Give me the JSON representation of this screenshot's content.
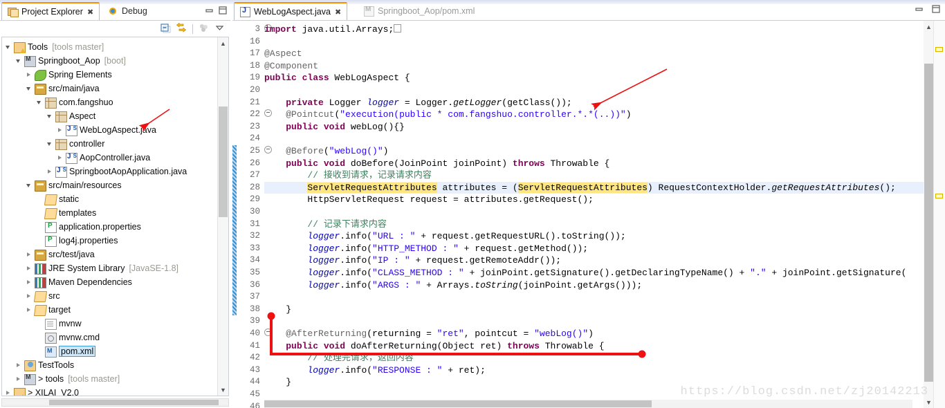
{
  "window": {
    "minimize_icon": "minimize-icon",
    "maximize_icon": "maximize-icon"
  },
  "left_view": {
    "tabs": [
      {
        "label": "Project Explorer",
        "icon": "project-explorer-icon",
        "active": true,
        "closable": true
      },
      {
        "label": "Debug",
        "icon": "debug-icon",
        "active": false,
        "closable": false
      }
    ],
    "toolbar": [
      {
        "name": "collapse-all-button",
        "icon": "collapse-all-icon"
      },
      {
        "name": "link-with-editor-button",
        "icon": "link-with-editor-icon"
      },
      {
        "name": "view-menu-button",
        "icon": "view-menu-icon"
      },
      {
        "name": "view-dropdown-button",
        "icon": "chevron-down-icon"
      }
    ],
    "tree": [
      {
        "indent": 0,
        "arrow": "open",
        "icon": "project-warn-icon",
        "name": "Tools",
        "meta": "[tools master]"
      },
      {
        "indent": 1,
        "arrow": "open",
        "icon": "git-project-icon",
        "name": "Springboot_Aop",
        "meta": "[boot]"
      },
      {
        "indent": 2,
        "arrow": "closed",
        "icon": "spring-icon",
        "name": "Spring Elements",
        "meta": ""
      },
      {
        "indent": 2,
        "arrow": "open",
        "icon": "source-folder-icon",
        "name": "src/main/java",
        "meta": ""
      },
      {
        "indent": 3,
        "arrow": "open",
        "icon": "package-icon",
        "name": "com.fangshuo",
        "meta": ""
      },
      {
        "indent": 4,
        "arrow": "open",
        "icon": "package-icon",
        "name": "Aspect",
        "meta": ""
      },
      {
        "indent": 5,
        "arrow": "closed",
        "icon": "java-class-icon",
        "name": "WebLogAspect.java",
        "meta": ""
      },
      {
        "indent": 4,
        "arrow": "open",
        "icon": "package-icon",
        "name": "controller",
        "meta": ""
      },
      {
        "indent": 5,
        "arrow": "closed",
        "icon": "java-class-icon",
        "name": "AopController.java",
        "meta": ""
      },
      {
        "indent": 4,
        "arrow": "closed",
        "icon": "java-class-icon",
        "name": "SpringbootAopApplication.java",
        "meta": ""
      },
      {
        "indent": 2,
        "arrow": "open",
        "icon": "source-folder-icon",
        "name": "src/main/resources",
        "meta": ""
      },
      {
        "indent": 3,
        "arrow": "none",
        "icon": "folder-open-icon",
        "name": "static",
        "meta": ""
      },
      {
        "indent": 3,
        "arrow": "none",
        "icon": "folder-open-icon",
        "name": "templates",
        "meta": ""
      },
      {
        "indent": 3,
        "arrow": "none",
        "icon": "properties-icon",
        "name": "application.properties",
        "meta": ""
      },
      {
        "indent": 3,
        "arrow": "none",
        "icon": "properties-icon",
        "name": "log4j.properties",
        "meta": ""
      },
      {
        "indent": 2,
        "arrow": "closed",
        "icon": "source-folder-icon",
        "name": "src/test/java",
        "meta": ""
      },
      {
        "indent": 2,
        "arrow": "closed",
        "icon": "library-icon",
        "name": "JRE System Library",
        "meta": "[JavaSE-1.8]"
      },
      {
        "indent": 2,
        "arrow": "closed",
        "icon": "library-icon",
        "name": "Maven Dependencies",
        "meta": ""
      },
      {
        "indent": 2,
        "arrow": "closed",
        "icon": "folder-open-icon",
        "name": "src",
        "meta": ""
      },
      {
        "indent": 2,
        "arrow": "closed",
        "icon": "folder-open-icon",
        "name": "target",
        "meta": ""
      },
      {
        "indent": 3,
        "arrow": "none",
        "icon": "file-icon",
        "name": "mvnw",
        "meta": ""
      },
      {
        "indent": 3,
        "arrow": "none",
        "icon": "cmd-file-icon",
        "name": "mvnw.cmd",
        "meta": ""
      },
      {
        "indent": 3,
        "arrow": "none",
        "icon": "maven-xml-icon",
        "name": "pom.xml",
        "meta": "",
        "selected": true
      },
      {
        "indent": 1,
        "arrow": "closed",
        "icon": "test-project-icon",
        "name": "TestTools",
        "meta": ""
      },
      {
        "indent": 1,
        "arrow": "closed",
        "icon": "git-project-icon",
        "name": "> tools",
        "meta": "[tools master]"
      },
      {
        "indent": 0,
        "arrow": "closed",
        "icon": "project-warn-icon",
        "name": "> XILAI_V2.0",
        "meta": ""
      }
    ]
  },
  "editor": {
    "tabs": [
      {
        "label": "WebLogAspect.java",
        "icon": "java-file-icon",
        "active": true,
        "closable": true
      },
      {
        "label": "Springboot_Aop/pom.xml",
        "icon": "maven-xml-icon",
        "active": false,
        "closable": false
      }
    ],
    "highlighted_line": 28,
    "changed_lines": {
      "from": 25,
      "to": 38
    },
    "lines": [
      {
        "n": "3",
        "fold": "plus",
        "tokens": [
          {
            "t": "kw",
            "v": "import"
          },
          {
            "t": "pln",
            "v": " java.util.Arrays;"
          },
          {
            "t": "box",
            "v": ""
          }
        ]
      },
      {
        "n": "16",
        "fold": "",
        "tokens": []
      },
      {
        "n": "17",
        "fold": "",
        "tokens": [
          {
            "t": "anno",
            "v": "@Aspect"
          }
        ]
      },
      {
        "n": "18",
        "fold": "",
        "tokens": [
          {
            "t": "anno",
            "v": "@Component"
          }
        ]
      },
      {
        "n": "19",
        "fold": "",
        "tokens": [
          {
            "t": "kw",
            "v": "public class"
          },
          {
            "t": "pln",
            "v": " WebLogAspect {"
          }
        ]
      },
      {
        "n": "20",
        "fold": "",
        "tokens": []
      },
      {
        "n": "21",
        "fold": "",
        "tokens": [
          {
            "t": "pln",
            "v": "    "
          },
          {
            "t": "kw",
            "v": "private"
          },
          {
            "t": "pln",
            "v": " Logger "
          },
          {
            "t": "fld",
            "v": "logger"
          },
          {
            "t": "pln",
            "v": " = Logger."
          },
          {
            "t": "mth",
            "v": "getLogger"
          },
          {
            "t": "pln",
            "v": "(getClass());"
          }
        ]
      },
      {
        "n": "22",
        "fold": "minus",
        "tokens": [
          {
            "t": "pln",
            "v": "    "
          },
          {
            "t": "anno",
            "v": "@Pointcut"
          },
          {
            "t": "pln",
            "v": "("
          },
          {
            "t": "str",
            "v": "\"execution(public * com.fangshuo.controller.*.*(..))\""
          },
          {
            "t": "pln",
            "v": ")"
          }
        ]
      },
      {
        "n": "23",
        "fold": "",
        "tokens": [
          {
            "t": "pln",
            "v": "    "
          },
          {
            "t": "kw",
            "v": "public void"
          },
          {
            "t": "pln",
            "v": " webLog(){}"
          }
        ]
      },
      {
        "n": "24",
        "fold": "",
        "tokens": []
      },
      {
        "n": "25",
        "fold": "minus",
        "tokens": [
          {
            "t": "pln",
            "v": "    "
          },
          {
            "t": "anno",
            "v": "@Before"
          },
          {
            "t": "pln",
            "v": "("
          },
          {
            "t": "str",
            "v": "\"webLog()\""
          },
          {
            "t": "pln",
            "v": ")"
          }
        ]
      },
      {
        "n": "26",
        "fold": "",
        "tokens": [
          {
            "t": "pln",
            "v": "    "
          },
          {
            "t": "kw",
            "v": "public void"
          },
          {
            "t": "pln",
            "v": " doBefore(JoinPoint joinPoint) "
          },
          {
            "t": "kw",
            "v": "throws"
          },
          {
            "t": "pln",
            "v": " Throwable {"
          }
        ]
      },
      {
        "n": "27",
        "fold": "",
        "tokens": [
          {
            "t": "cmt",
            "v": "        // 接收到请求，记录请求内容"
          }
        ]
      },
      {
        "n": "28",
        "fold": "",
        "tokens": [
          {
            "t": "pln",
            "v": "        "
          },
          {
            "t": "mark",
            "v": "ServletRequestAttributes"
          },
          {
            "t": "pln",
            "v": " attributes = ("
          },
          {
            "t": "mark",
            "v": "ServletRequestAttributes"
          },
          {
            "t": "pln",
            "v": ") RequestContextHolder."
          },
          {
            "t": "mth",
            "v": "getRequestAttributes"
          },
          {
            "t": "pln",
            "v": "();"
          }
        ]
      },
      {
        "n": "29",
        "fold": "",
        "tokens": [
          {
            "t": "pln",
            "v": "        HttpServletRequest request = attributes.getRequest();"
          }
        ]
      },
      {
        "n": "30",
        "fold": "",
        "tokens": []
      },
      {
        "n": "31",
        "fold": "",
        "tokens": [
          {
            "t": "cmt",
            "v": "        // 记录下请求内容"
          }
        ]
      },
      {
        "n": "32",
        "fold": "",
        "tokens": [
          {
            "t": "pln",
            "v": "        "
          },
          {
            "t": "fld",
            "v": "logger"
          },
          {
            "t": "pln",
            "v": ".info("
          },
          {
            "t": "str",
            "v": "\"URL : \""
          },
          {
            "t": "pln",
            "v": " + request.getRequestURL().toString());"
          }
        ]
      },
      {
        "n": "33",
        "fold": "",
        "tokens": [
          {
            "t": "pln",
            "v": "        "
          },
          {
            "t": "fld",
            "v": "logger"
          },
          {
            "t": "pln",
            "v": ".info("
          },
          {
            "t": "str",
            "v": "\"HTTP_METHOD : \""
          },
          {
            "t": "pln",
            "v": " + request.getMethod());"
          }
        ]
      },
      {
        "n": "34",
        "fold": "",
        "tokens": [
          {
            "t": "pln",
            "v": "        "
          },
          {
            "t": "fld",
            "v": "logger"
          },
          {
            "t": "pln",
            "v": ".info("
          },
          {
            "t": "str",
            "v": "\"IP : \""
          },
          {
            "t": "pln",
            "v": " + request.getRemoteAddr());"
          }
        ]
      },
      {
        "n": "35",
        "fold": "",
        "tokens": [
          {
            "t": "pln",
            "v": "        "
          },
          {
            "t": "fld",
            "v": "logger"
          },
          {
            "t": "pln",
            "v": ".info("
          },
          {
            "t": "str",
            "v": "\"CLASS_METHOD : \""
          },
          {
            "t": "pln",
            "v": " + joinPoint.getSignature().getDeclaringTypeName() + "
          },
          {
            "t": "str",
            "v": "\".\""
          },
          {
            "t": "pln",
            "v": " + joinPoint.getSignature("
          }
        ]
      },
      {
        "n": "36",
        "fold": "",
        "tokens": [
          {
            "t": "pln",
            "v": "        "
          },
          {
            "t": "fld",
            "v": "logger"
          },
          {
            "t": "pln",
            "v": ".info("
          },
          {
            "t": "str",
            "v": "\"ARGS : \""
          },
          {
            "t": "pln",
            "v": " + Arrays."
          },
          {
            "t": "mth",
            "v": "toString"
          },
          {
            "t": "pln",
            "v": "(joinPoint.getArgs()));"
          }
        ]
      },
      {
        "n": "37",
        "fold": "",
        "tokens": []
      },
      {
        "n": "38",
        "fold": "",
        "tokens": [
          {
            "t": "pln",
            "v": "    }"
          }
        ]
      },
      {
        "n": "39",
        "fold": "",
        "tokens": []
      },
      {
        "n": "40",
        "fold": "minus",
        "tokens": [
          {
            "t": "pln",
            "v": "    "
          },
          {
            "t": "anno",
            "v": "@AfterReturning"
          },
          {
            "t": "pln",
            "v": "(returning = "
          },
          {
            "t": "str",
            "v": "\"ret\""
          },
          {
            "t": "pln",
            "v": ", pointcut = "
          },
          {
            "t": "str",
            "v": "\"webLog()\""
          },
          {
            "t": "pln",
            "v": ")"
          }
        ]
      },
      {
        "n": "41",
        "fold": "",
        "tokens": [
          {
            "t": "pln",
            "v": "    "
          },
          {
            "t": "kw",
            "v": "public void"
          },
          {
            "t": "pln",
            "v": " doAfterReturning(Object ret) "
          },
          {
            "t": "kw",
            "v": "throws"
          },
          {
            "t": "pln",
            "v": " Throwable {"
          }
        ]
      },
      {
        "n": "42",
        "fold": "",
        "tokens": [
          {
            "t": "cmt",
            "v": "        // 处理完请求，返回内容"
          }
        ]
      },
      {
        "n": "43",
        "fold": "",
        "tokens": [
          {
            "t": "pln",
            "v": "        "
          },
          {
            "t": "fld",
            "v": "logger"
          },
          {
            "t": "pln",
            "v": ".info("
          },
          {
            "t": "str",
            "v": "\"RESPONSE : \""
          },
          {
            "t": "pln",
            "v": " + ret);"
          }
        ]
      },
      {
        "n": "44",
        "fold": "",
        "tokens": [
          {
            "t": "pln",
            "v": "    }"
          }
        ]
      },
      {
        "n": "45",
        "fold": "",
        "tokens": []
      },
      {
        "n": "46",
        "fold": "",
        "tokens": [
          {
            "t": "pln",
            "v": "}"
          }
        ]
      }
    ]
  },
  "watermark": "https://blog.csdn.net/zj20142213",
  "annotations": {
    "color": "#ee1111",
    "items": [
      {
        "name": "arrow-annotation-tree",
        "kind": "arrow"
      },
      {
        "name": "arrow-annotation-code",
        "kind": "arrow"
      },
      {
        "name": "bracket-annotation-code",
        "kind": "elbow"
      }
    ]
  },
  "colors": {
    "accent": "#ff8c00",
    "keyword": "#7f0055",
    "string": "#2a00ff",
    "comment": "#3f7f5f",
    "field": "#0000c0",
    "annotation": "#646464",
    "occurrence_highlight": "#ffe680",
    "current_line": "#e8f0fe",
    "selection": "#cfe6f7"
  }
}
